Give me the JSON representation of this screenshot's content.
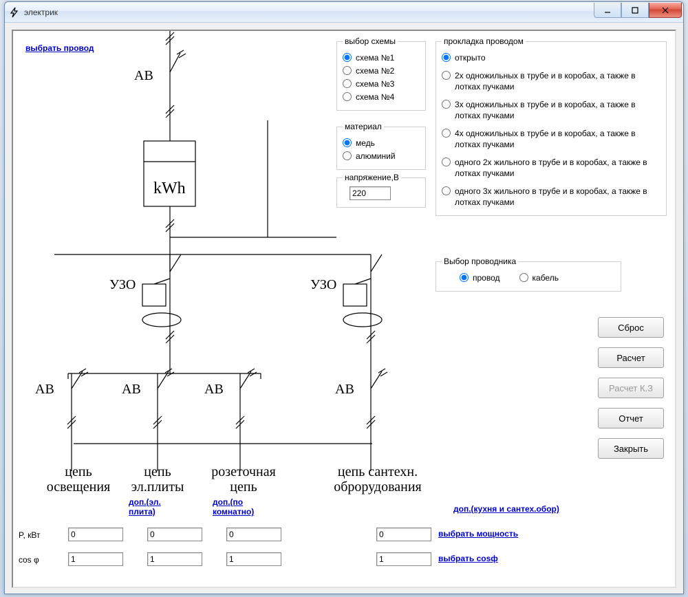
{
  "window": {
    "title": "электрик"
  },
  "links": {
    "select_wire": "выбрать провод",
    "dop_plita": "доп.(эл. плита)",
    "dop_room": "доп.(по комнатно)",
    "dop_kitchen": "доп.(кухня и сантех.обор)",
    "select_power": "выбрать мощность",
    "select_cos": "выбрать cosф"
  },
  "groups": {
    "scheme": {
      "legend": "выбор схемы",
      "options": [
        "схема №1",
        "схема №2",
        "схема №3",
        "схема №4"
      ],
      "selected": 0
    },
    "material": {
      "legend": "материал",
      "options": [
        "медь",
        "алюминий"
      ],
      "selected": 0
    },
    "voltage": {
      "legend": "напряжение,В",
      "value": "220"
    },
    "laying": {
      "legend": "прокладка проводом",
      "options": [
        "открыто",
        "2х одножильных в трубе и в коробах, а также в лотках пучками",
        "3х одножильных в трубе и в коробах, а также в лотках пучками",
        "4х одножильных в трубе и в коробах, а также в лотках пучками",
        "одного 2х жильного в трубе и в коробах, а также в лотках пучками",
        "одного 3х жильного в трубе и в коробах, а также в лотках пучками"
      ],
      "selected": 0
    },
    "conductor": {
      "legend": "Выбор проводника",
      "options": [
        "провод",
        "кабель"
      ],
      "selected": 0
    }
  },
  "buttons": {
    "reset": "Сброс",
    "calc": "Расчет",
    "calc_kz": "Расчет К.З",
    "report": "Отчет",
    "close": "Закрыть"
  },
  "schematic": {
    "ab": "АВ",
    "kwh": "kWh",
    "uzo": "УЗО",
    "circuit_labels": [
      "цепь освещения",
      "цепь эл.плиты",
      "розеточная цепь",
      "цепь сантехн. оброрудования"
    ]
  },
  "row_labels": {
    "p": "P, кВт",
    "cos": "cos φ"
  },
  "inputs": {
    "p": [
      "0",
      "0",
      "0",
      "0"
    ],
    "cos": [
      "1",
      "1",
      "1",
      "1"
    ]
  }
}
